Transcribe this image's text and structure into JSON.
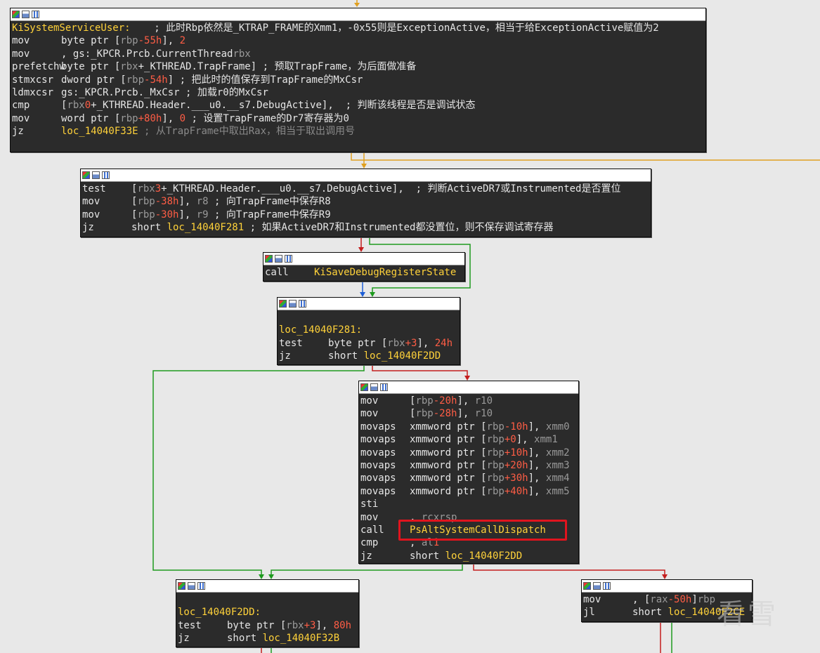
{
  "colors": {
    "background": "#e8e8e8",
    "node_bg": "#2b2b2b",
    "label": "#ffd23a",
    "register": "#9a9a9a",
    "number": "#ff5d45",
    "edge_true": "#1f9a1f",
    "edge_false": "#c41e1e",
    "edge_uncond": "#1f5fd6",
    "edge_jump": "#e0a020",
    "highlight": "#e0141e"
  },
  "watermark": "看雪",
  "nodes": {
    "n1": {
      "lines": [
        {
          "a": "KiSystemServiceUser:",
          "b": "",
          "c": "; 此时Rbp依然是_KTRAP_FRAME的Xmm1，-0x55则是ExceptionActive，相当于给ExceptionActive赋值为2"
        },
        {
          "a": "mov",
          "b1": "byte ptr [",
          "r1": "rbp",
          "n1": "-55h",
          "b2": "], ",
          "n2": "2",
          "c": ""
        },
        {
          "a": "mov",
          "r1": "rbx",
          "b1": ", gs:_KPCR.Prcb.CurrentThread",
          "c": ""
        },
        {
          "a": "prefetchw",
          "b1": "byte ptr [",
          "r1": "rbx",
          "b2": "+_KTHREAD.TrapFrame]",
          "c": "; 预取TrapFrame，为后面做准备"
        },
        {
          "a": "stmxcsr",
          "b1": "dword ptr [",
          "r1": "rbp",
          "n1": "-54h",
          "b2": "]",
          "c": "; 把此时的值保存到TrapFrame的MxCsr"
        },
        {
          "a": "ldmxcsr",
          "b1": "gs:_KPCR.Prcb._MxCsr",
          "c": "; 加载r0的MxCsr"
        },
        {
          "a": "cmp",
          "b1": "[",
          "r1": "rbx",
          "b2": "+_KTHREAD.Header.___u0.__s7.DebugActive], ",
          "n1": "0",
          "c": "; 判断该线程是否是调试状态"
        },
        {
          "a": "mov",
          "b1": "word ptr [",
          "r1": "rbp",
          "n1": "+80h",
          "b2": "], ",
          "n2": "0",
          "c": "; 设置TrapFrame的Dr7寄存器为0"
        },
        {
          "a": "jz",
          "lbl": "loc_14040F33E",
          "c": "; 从TrapFrame中取出Rax，相当于取出调用号"
        }
      ]
    },
    "n2": {
      "lines": [
        {
          "a": "test",
          "b1": "[",
          "r1": "rbx",
          "b2": "+_KTHREAD.Header.___u0.__s7.DebugActive], ",
          "n1": "3",
          "c": "; 判断ActiveDR7或Instrumented是否置位"
        },
        {
          "a": "mov",
          "b1": "[",
          "r1": "rbp",
          "n1": "-38h",
          "b2": "], ",
          "r2": "r8",
          "c": "; 向TrapFrame中保存R8"
        },
        {
          "a": "mov",
          "b1": "[",
          "r1": "rbp",
          "n1": "-30h",
          "b2": "], ",
          "r2": "r9",
          "c": "; 向TrapFrame中保存R9"
        },
        {
          "a": "jz",
          "b1": "short ",
          "lbl": "loc_14040F281",
          "c": "; 如果ActiveDR7和Instrumented都没置位，则不保存调试寄存器"
        }
      ]
    },
    "n3": {
      "lines": [
        {
          "a": "call",
          "lbl": "KiSaveDebugRegisterState"
        }
      ]
    },
    "n4": {
      "lines": [
        {
          "a": "",
          "b": "",
          "c": ""
        },
        {
          "a": "loc_14040F281:"
        },
        {
          "a": "test",
          "b1": "byte ptr [",
          "r1": "rbx",
          "n1": "+3",
          "b2": "], ",
          "n2": "24h"
        },
        {
          "a": "jz",
          "b1": "short ",
          "lbl": "loc_14040F2DD"
        }
      ]
    },
    "n5": {
      "lines": [
        {
          "a": "mov",
          "b1": "[",
          "r1": "rbp",
          "n1": "-20h",
          "b2": "], ",
          "r2": "r10"
        },
        {
          "a": "mov",
          "b1": "[",
          "r1": "rbp",
          "n1": "-28h",
          "b2": "], ",
          "r2": "r10"
        },
        {
          "a": "movaps",
          "b1": "xmmword ptr [",
          "r1": "rbp",
          "n1": "-10h",
          "b2": "], ",
          "r2": "xmm0"
        },
        {
          "a": "movaps",
          "b1": "xmmword ptr [",
          "r1": "rbp",
          "n1": "+0",
          "b2": "], ",
          "r2": "xmm1"
        },
        {
          "a": "movaps",
          "b1": "xmmword ptr [",
          "r1": "rbp",
          "n1": "+10h",
          "b2": "], ",
          "r2": "xmm2"
        },
        {
          "a": "movaps",
          "b1": "xmmword ptr [",
          "r1": "rbp",
          "n1": "+20h",
          "b2": "], ",
          "r2": "xmm3"
        },
        {
          "a": "movaps",
          "b1": "xmmword ptr [",
          "r1": "rbp",
          "n1": "+30h",
          "b2": "], ",
          "r2": "xmm4"
        },
        {
          "a": "movaps",
          "b1": "xmmword ptr [",
          "r1": "rbp",
          "n1": "+40h",
          "b2": "], ",
          "r2": "xmm5"
        },
        {
          "a": "sti"
        },
        {
          "a": "mov",
          "r1": "rcx",
          "b1": ", ",
          "r2": "rsp"
        },
        {
          "a": "call",
          "lbl": "PsAltSystemCallDispatch"
        },
        {
          "a": "cmp",
          "r1": "al",
          "b1": ", ",
          "n1": "1"
        },
        {
          "a": "jz",
          "b1": "short ",
          "lbl": "loc_14040F2DD"
        }
      ]
    },
    "n6": {
      "lines": [
        {
          "a": "",
          "b": "",
          "c": ""
        },
        {
          "a": "loc_14040F2DD:"
        },
        {
          "a": "test",
          "b1": "byte ptr [",
          "r1": "rbx",
          "n1": "+3",
          "b2": "], ",
          "n2": "80h"
        },
        {
          "a": "jz",
          "b1": "short ",
          "lbl": "loc_14040F32B"
        }
      ]
    },
    "n7": {
      "lines": [
        {
          "a": "mov",
          "r1": "rax",
          "b1": ", [",
          "r2": "rbp",
          "n1": "-50h",
          "b2": "]"
        },
        {
          "a": "jl",
          "b1": "short ",
          "lbl": "loc_14040F2CE"
        }
      ]
    }
  }
}
